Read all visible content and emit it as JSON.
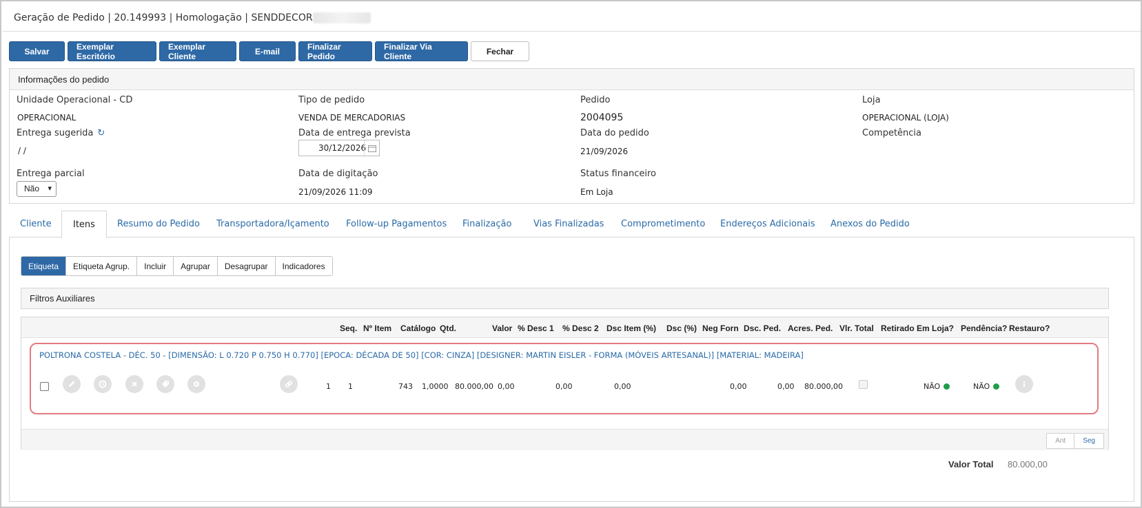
{
  "window": {
    "title": "Geração de Pedido | 20.149993 | Homologação | SENDDECOR"
  },
  "toolbar": {
    "salvar": "Salvar",
    "exemplar_escritorio": "Exemplar Escritório",
    "exemplar_cliente": "Exemplar Cliente",
    "email": "E-mail",
    "finalizar_pedido": "Finalizar Pedido",
    "finalizar_via_cliente": "Finalizar Via Cliente",
    "fechar": "Fechar"
  },
  "info": {
    "header": "Informações do pedido",
    "unidade_label": "Unidade Operacional - CD",
    "unidade_value": "OPERACIONAL",
    "tipo_label": "Tipo de pedido",
    "tipo_value": "VENDA DE MERCADORIAS",
    "pedido_label": "Pedido",
    "pedido_value": "2004095",
    "loja_label": "Loja",
    "loja_value": "OPERACIONAL (LOJA)",
    "entrega_sugerida_label": "Entrega sugerida",
    "entrega_sugerida_value": "/ /",
    "data_entrega_label": "Data de entrega prevista",
    "data_entrega_value": "30/12/2026",
    "data_pedido_label": "Data do pedido",
    "data_pedido_value": "21/09/2026",
    "competencia_label": "Competência",
    "entrega_parcial_label": "Entrega parcial",
    "entrega_parcial_value": "Não",
    "data_digitacao_label": "Data de digitação",
    "data_digitacao_value": "21/09/2026 11:09",
    "status_financeiro_label": "Status financeiro",
    "status_financeiro_value": "Em Loja"
  },
  "tabs": [
    {
      "label": "Cliente"
    },
    {
      "label": "Itens"
    },
    {
      "label": "Resumo do Pedido"
    },
    {
      "label": "Transportadora/Içamento"
    },
    {
      "label": "Follow-up Pagamentos"
    },
    {
      "label": "Finalização"
    },
    {
      "label": "Vias Finalizadas"
    },
    {
      "label": "Comprometimento"
    },
    {
      "label": "Endereços Adicionais"
    },
    {
      "label": "Anexos do Pedido"
    }
  ],
  "subtabs": [
    {
      "label": "Etiqueta"
    },
    {
      "label": "Etiqueta Agrup."
    },
    {
      "label": "Incluir"
    },
    {
      "label": "Agrupar"
    },
    {
      "label": "Desagrupar"
    },
    {
      "label": "Indicadores"
    }
  ],
  "filters": {
    "label": "Filtros Auxiliares"
  },
  "grid": {
    "columns": [
      "Seq.",
      "Nº Item",
      "Catálogo",
      "Qtd.",
      "Valor",
      "% Desc 1",
      "% Desc 2",
      "Dsc Item (%)",
      "Dsc (%)",
      "Neg Forn",
      "Dsc. Ped.",
      "Acres. Ped.",
      "Vlr. Total",
      "Retirado Em Loja?",
      "Pendência?",
      "Restauro?"
    ],
    "row": {
      "description": "POLTRONA COSTELA - DÉC. 50 - [DIMENSÃO: L 0.720 P 0.750 H 0.770] [EPOCA: DÉCADA DE 50] [COR: CINZA] [DESIGNER: MARTIN EISLER - FORMA (MÓVEIS ARTESANAL)] [MATERIAL: MADEIRA]",
      "seq": "1",
      "n_item": "1",
      "catalogo": "743",
      "qtd": "1,0000",
      "valor": "80.000,00",
      "desc1": "0,00",
      "desc2": "0,00",
      "dsc_item": "0,00",
      "dsc_ped": "0,00",
      "acres_ped": "0,00",
      "vlr_total": "80.000,00",
      "pendencia": "NÃO",
      "restauro": "NÃO"
    },
    "pager": {
      "prev": "Ant",
      "next": "Seg"
    }
  },
  "totals": {
    "label": "Valor Total",
    "value": "80.000,00"
  },
  "colors": {
    "primary": "#2e69a6",
    "link": "#2a6aa6",
    "highlight_border": "#e37a80",
    "status_ok": "#1f9d4a"
  },
  "icons": [
    "refresh-icon",
    "calendar-icon",
    "edit-icon",
    "history-icon",
    "remove-icon",
    "tag-icon",
    "gear-icon",
    "link-icon",
    "info-icon",
    "chevron-down-icon"
  ]
}
